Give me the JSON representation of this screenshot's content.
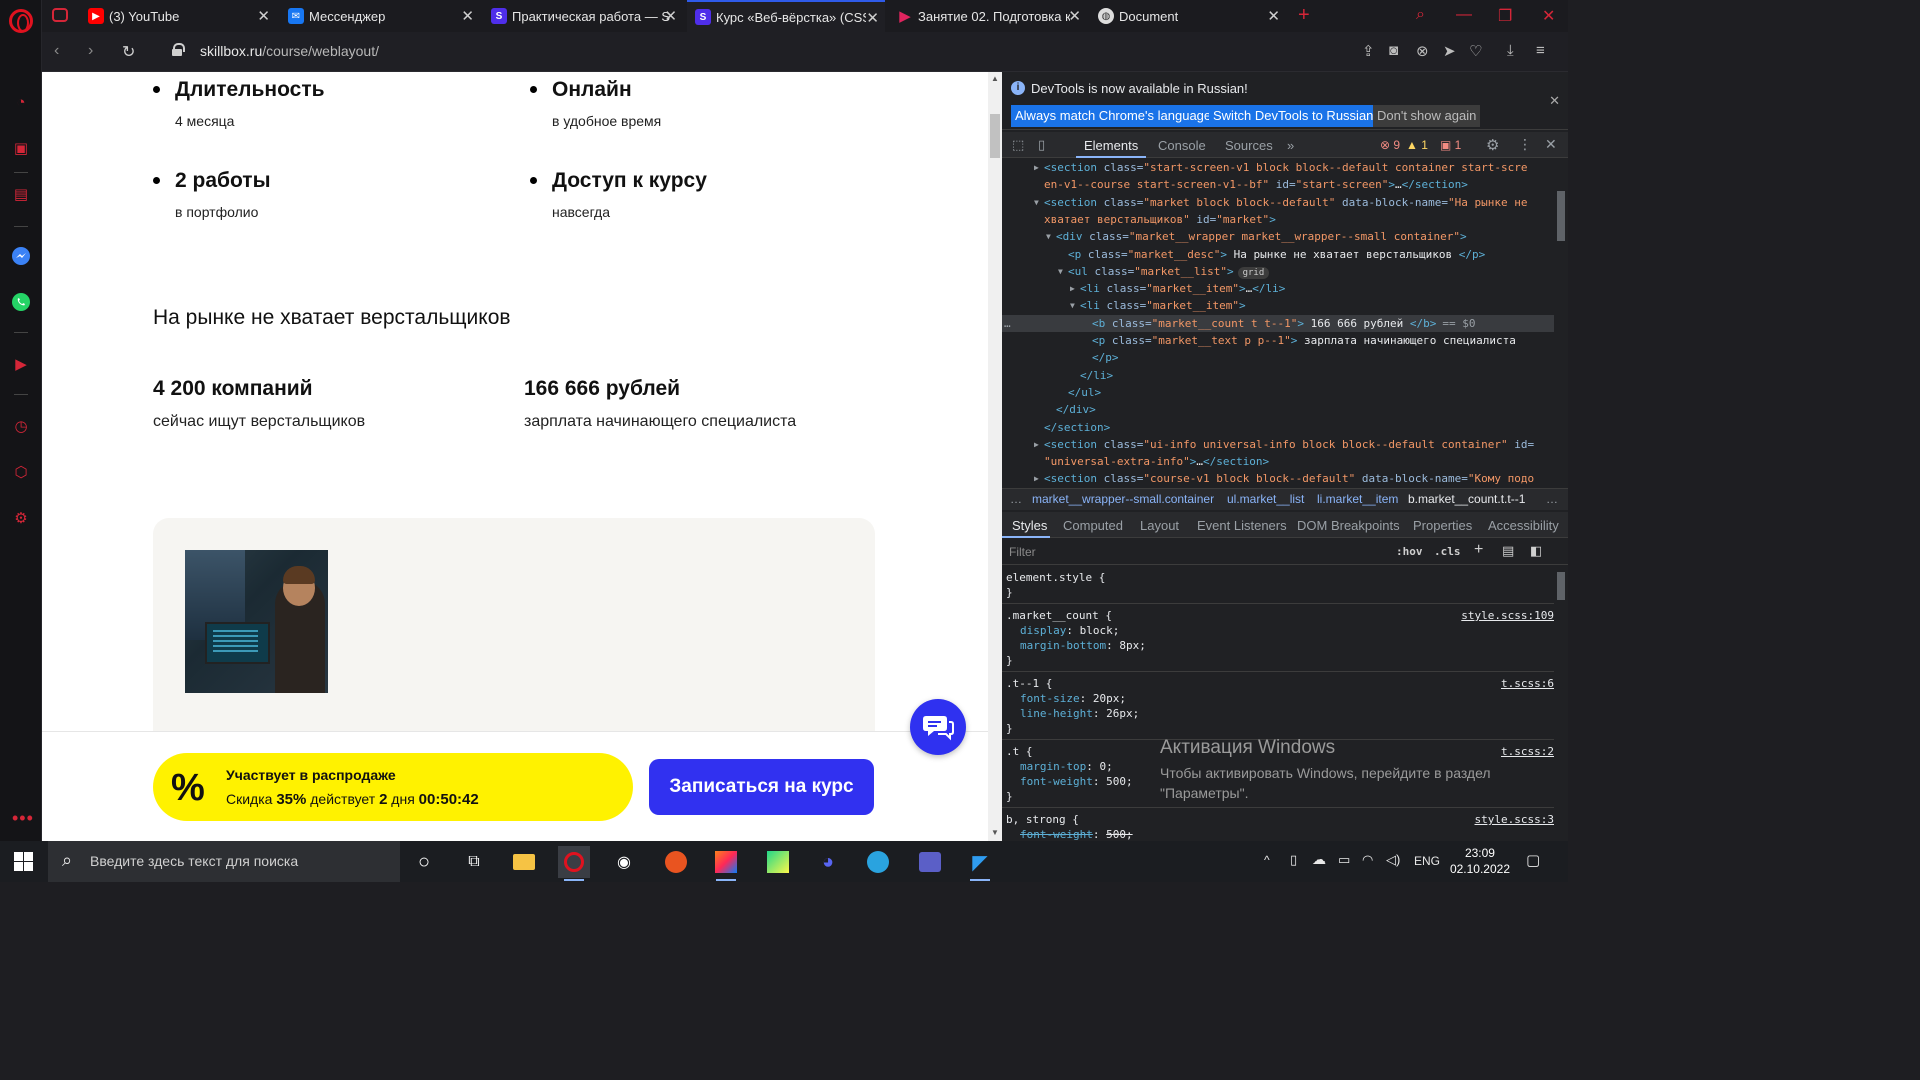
{
  "browser": {
    "tabs": [
      {
        "label": "(3) YouTube",
        "icon": "youtube-icon",
        "color": "#ff0000"
      },
      {
        "label": "Мессенджер",
        "icon": "messenger-icon",
        "color": "#1877f2"
      },
      {
        "label": "Практическая работа — S",
        "icon": "skillbox-icon",
        "color": "#4f2eea"
      },
      {
        "label": "Курс «Веб-вёрстка» (CSS и",
        "icon": "skillbox-icon",
        "color": "#4f2eea"
      },
      {
        "label": "Занятие 02. Подготовка к",
        "icon": "play-icon",
        "color": "#e0245e"
      },
      {
        "label": "Document",
        "icon": "globe-icon",
        "color": "#dddddd"
      }
    ],
    "url_domain": "skillbox.ru",
    "url_path": "/course/weblayout/"
  },
  "page": {
    "features": [
      {
        "title": "Длительность",
        "subtitle": "4 месяца"
      },
      {
        "title": "Онлайн",
        "subtitle": "в удобное время"
      },
      {
        "title": "2 работы",
        "subtitle": "в портфолио"
      },
      {
        "title": "Доступ к курсу",
        "subtitle": "навсегда"
      }
    ],
    "market_desc": "На рынке не хватает верстальщиков",
    "market_items": [
      {
        "count": "4 200 компаний",
        "text": "сейчас ищут верстальщиков"
      },
      {
        "count": "166 666 рублей",
        "text": "зарплата начинающего специалиста"
      }
    ],
    "sale": {
      "percent": "%",
      "title": "Участвует в распродаже",
      "discount_prefix": "Скидка",
      "discount_value": "35%",
      "discount_mid": "действует",
      "days_value": "2",
      "days_label": "дня",
      "timer": "00:50:42"
    },
    "enroll_label": "Записаться на курс"
  },
  "devtools": {
    "info_message": "DevTools is now available in Russian!",
    "btn_match": "Always match Chrome's language",
    "btn_switch": "Switch DevTools to Russian",
    "btn_dont_show": "Don't show again",
    "tabs": [
      "Elements",
      "Console",
      "Sources"
    ],
    "errors": "9",
    "warnings": "1",
    "issues": "1",
    "breadcrumbs": [
      "…",
      "market__wrapper--small.container",
      "ul.market__list",
      "li.market__item",
      "b.market__count.t.t--1",
      "…"
    ],
    "styles_tabs": [
      "Styles",
      "Computed",
      "Layout",
      "Event Listeners",
      "DOM Breakpoints",
      "Properties",
      "Accessibility"
    ],
    "filter_placeholder": "Filter",
    "hov": ":hov",
    "cls": ".cls",
    "grid_badge": "grid",
    "selected_marker": "== $0",
    "dom_lines": [
      {
        "indent": 0,
        "arrow": "▶",
        "parts": [
          [
            "tag",
            "<section "
          ],
          [
            "an",
            "class="
          ],
          [
            "av",
            "\"start-screen-v1 block block--default container  start-scre"
          ]
        ]
      },
      {
        "indent": 0,
        "arrow": "",
        "parts": [
          [
            "av",
            "en-v1--course  start-screen-v1--bf\""
          ],
          [
            "an",
            " id="
          ],
          [
            "av",
            "\"start-screen\""
          ],
          [
            "tag",
            ">"
          ],
          [
            "tx",
            "…"
          ],
          [
            "tag",
            "</section>"
          ]
        ]
      },
      {
        "indent": 0,
        "arrow": "▼",
        "parts": [
          [
            "tag",
            "<section "
          ],
          [
            "an",
            "class="
          ],
          [
            "av",
            "\"market block block--default\""
          ],
          [
            "an",
            " data-block-name="
          ],
          [
            "av",
            "\"На рынке не"
          ]
        ]
      },
      {
        "indent": 0,
        "arrow": "",
        "parts": [
          [
            "av",
            "хватает верстальщиков\""
          ],
          [
            "an",
            " id="
          ],
          [
            "av",
            "\"market\""
          ],
          [
            "tag",
            ">"
          ]
        ]
      },
      {
        "indent": 1,
        "arrow": "▼",
        "parts": [
          [
            "tag",
            "<div "
          ],
          [
            "an",
            "class="
          ],
          [
            "av",
            "\"market__wrapper market__wrapper--small container\""
          ],
          [
            "tag",
            ">"
          ]
        ]
      },
      {
        "indent": 2,
        "arrow": "",
        "parts": [
          [
            "tag",
            "<p "
          ],
          [
            "an",
            "class="
          ],
          [
            "av",
            "\"market__desc\""
          ],
          [
            "tag",
            "> "
          ],
          [
            "tx",
            "На рынке не хватает верстальщиков "
          ],
          [
            "tag",
            "</p>"
          ]
        ]
      },
      {
        "indent": 2,
        "arrow": "▼",
        "parts": [
          [
            "tag",
            "<ul "
          ],
          [
            "an",
            "class="
          ],
          [
            "av",
            "\"market__list\""
          ],
          [
            "tag",
            ">"
          ]
        ]
      },
      {
        "indent": 3,
        "arrow": "▶",
        "parts": [
          [
            "tag",
            "<li "
          ],
          [
            "an",
            "class="
          ],
          [
            "av",
            "\"market__item\""
          ],
          [
            "tag",
            ">"
          ],
          [
            "tx",
            "…"
          ],
          [
            "tag",
            "</li>"
          ]
        ]
      },
      {
        "indent": 3,
        "arrow": "▼",
        "parts": [
          [
            "tag",
            "<li "
          ],
          [
            "an",
            "class="
          ],
          [
            "av",
            "\"market__item\""
          ],
          [
            "tag",
            ">"
          ]
        ]
      },
      {
        "indent": 4,
        "arrow": "",
        "parts": [
          [
            "tag",
            "<b "
          ],
          [
            "an",
            "class="
          ],
          [
            "av",
            "\"market__count t t--1\""
          ],
          [
            "tag",
            "> "
          ],
          [
            "tx",
            "166 666 рублей "
          ],
          [
            "tag",
            "</b>"
          ]
        ]
      },
      {
        "indent": 4,
        "arrow": "",
        "parts": [
          [
            "tag",
            "<p "
          ],
          [
            "an",
            "class="
          ],
          [
            "av",
            "\"market__text p p--1\""
          ],
          [
            "tag",
            "> "
          ],
          [
            "tx",
            "зарплата начинающего специалиста"
          ]
        ]
      },
      {
        "indent": 4,
        "arrow": "",
        "parts": [
          [
            "tag",
            "</p>"
          ]
        ]
      },
      {
        "indent": 3,
        "arrow": "",
        "parts": [
          [
            "tag",
            "</li>"
          ]
        ]
      },
      {
        "indent": 2,
        "arrow": "",
        "parts": [
          [
            "tag",
            "</ul>"
          ]
        ]
      },
      {
        "indent": 1,
        "arrow": "",
        "parts": [
          [
            "tag",
            "</div>"
          ]
        ]
      },
      {
        "indent": 0,
        "arrow": "",
        "parts": [
          [
            "tag",
            "</section>"
          ]
        ]
      },
      {
        "indent": 0,
        "arrow": "▶",
        "parts": [
          [
            "tag",
            "<section "
          ],
          [
            "an",
            "class="
          ],
          [
            "av",
            "\"ui-info universal-info block block--default container\""
          ],
          [
            "an",
            " id="
          ]
        ]
      },
      {
        "indent": 0,
        "arrow": "",
        "parts": [
          [
            "av",
            "\"universal-extra-info\""
          ],
          [
            "tag",
            ">"
          ],
          [
            "tx",
            "…"
          ],
          [
            "tag",
            "</section>"
          ]
        ]
      },
      {
        "indent": 0,
        "arrow": "▶",
        "parts": [
          [
            "tag",
            "<section "
          ],
          [
            "an",
            "class="
          ],
          [
            "av",
            "\"course-v1 block block--default\""
          ],
          [
            "an",
            " data-block-name="
          ],
          [
            "av",
            "\"Кому подо"
          ]
        ]
      }
    ],
    "css_rules": [
      {
        "selector": "element.style {",
        "source": "",
        "props": []
      },
      {
        "selector": ".market__count {",
        "source": "style.scss:109",
        "props": [
          [
            "display",
            "block;"
          ],
          [
            "margin-bottom",
            "8px;"
          ]
        ]
      },
      {
        "selector": ".t--1 {",
        "source": "t.scss:6",
        "props": [
          [
            "font-size",
            "20px;"
          ],
          [
            "line-height",
            "26px;"
          ]
        ]
      },
      {
        "selector": ".t {",
        "source": "t.scss:2",
        "props": [
          [
            "margin-top",
            "0;"
          ],
          [
            "font-weight",
            "500;"
          ]
        ]
      },
      {
        "selector": "b, strong {",
        "source": "style.scss:3",
        "props": [
          [
            "font-weight",
            "500;"
          ]
        ]
      }
    ]
  },
  "windows_activation": {
    "title": "Активация Windows",
    "text": "Чтобы активировать Windows, перейдите в раздел \"Параметры\"."
  },
  "taskbar": {
    "search_placeholder": "Введите здесь текст для поиска",
    "language": "ENG",
    "time": "23:09",
    "date": "02.10.2022"
  }
}
